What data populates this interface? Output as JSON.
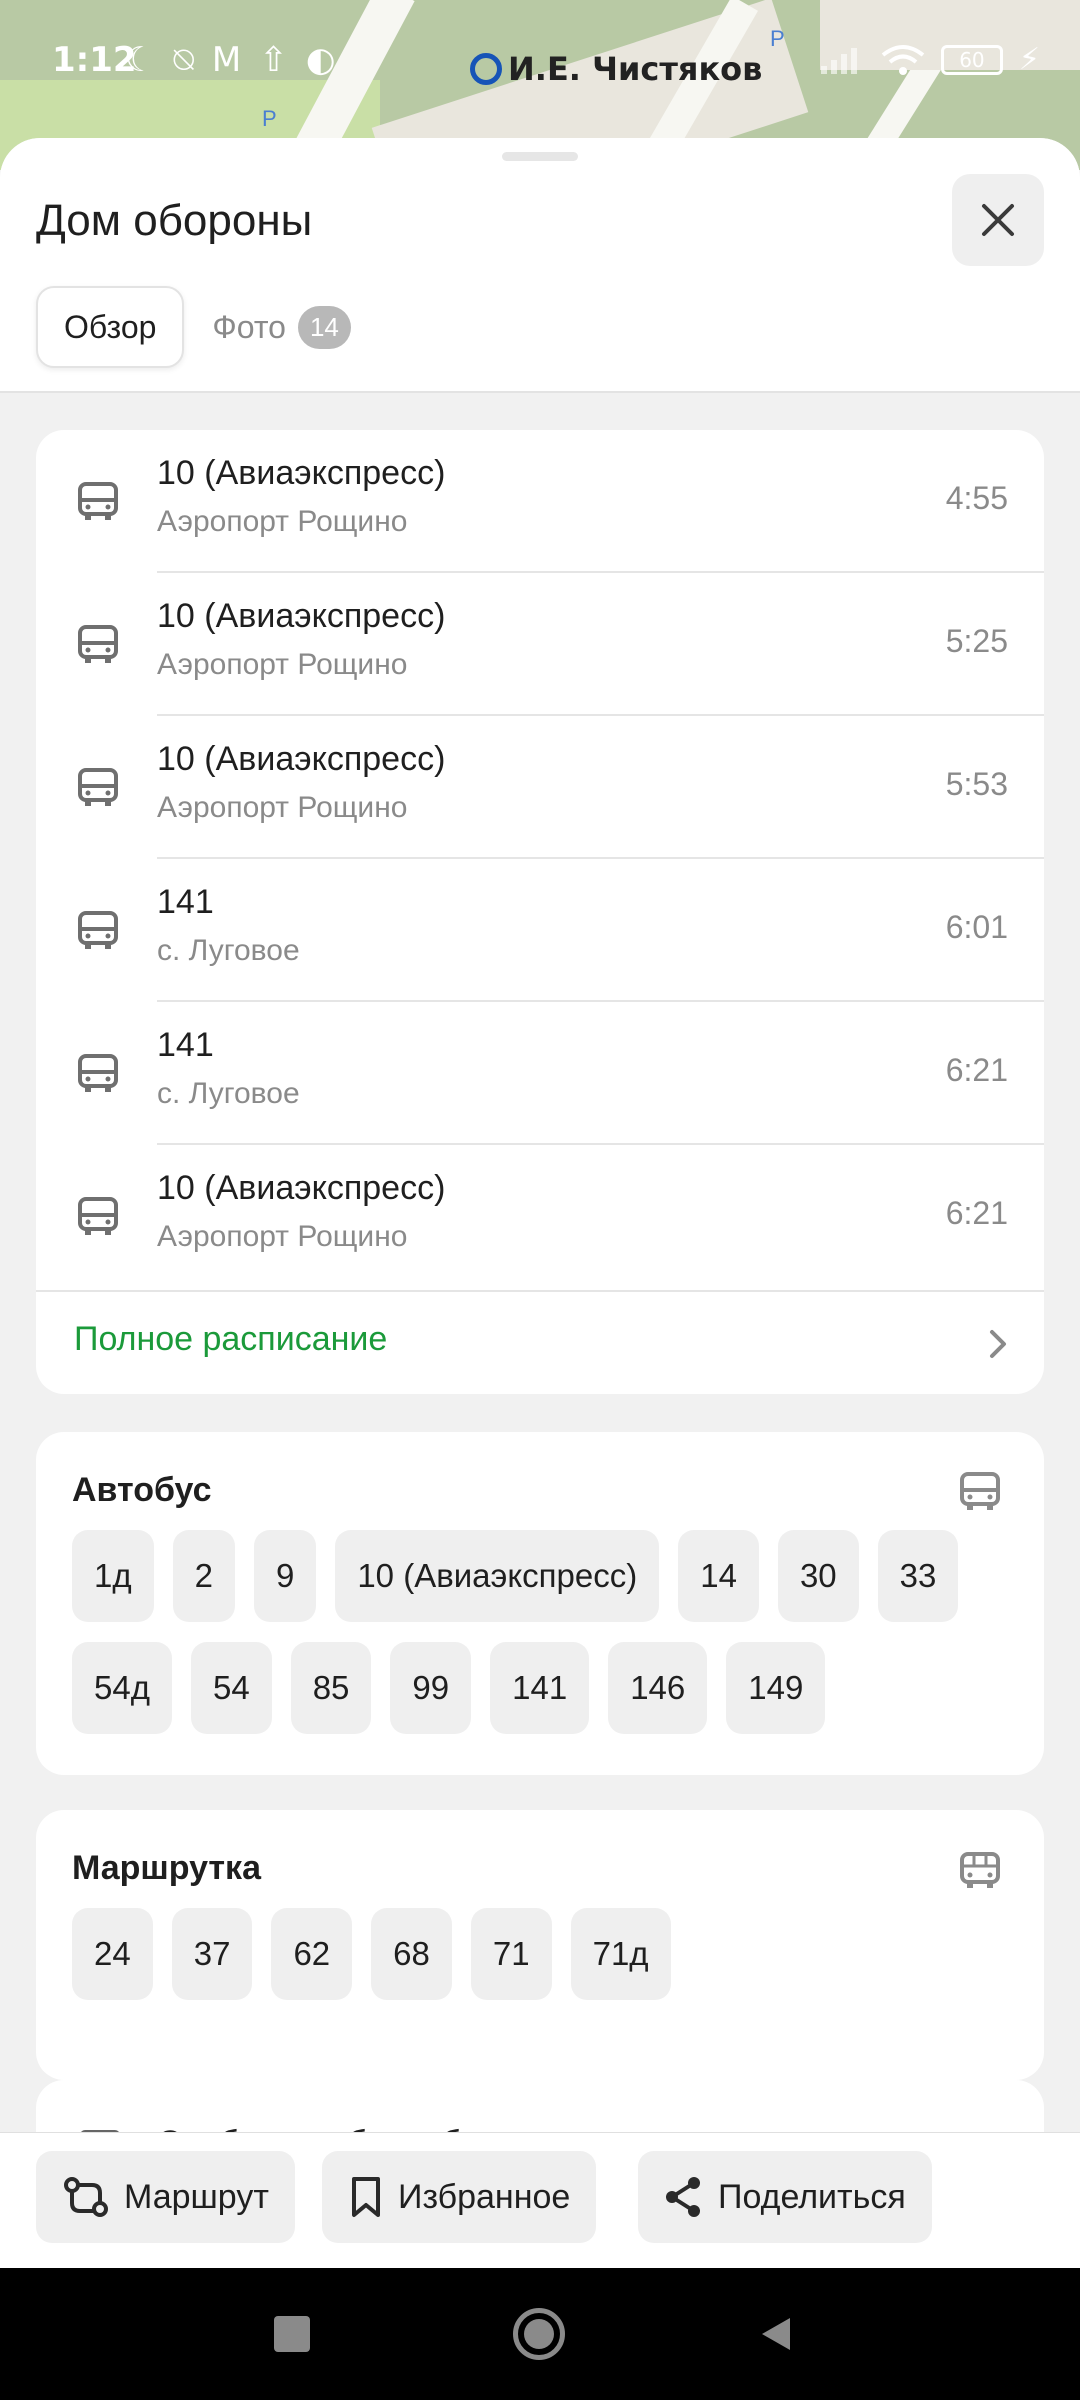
{
  "status_bar": {
    "time": "1:12",
    "battery": "60",
    "metro_station": "И.Е. Чистяков"
  },
  "map": {
    "parking_label": "P"
  },
  "sheet": {
    "title": "Дом обороны",
    "tabs": [
      {
        "label": "Обзор",
        "active": true
      },
      {
        "label": "Фото",
        "badge": "14",
        "active": false
      }
    ]
  },
  "schedule": {
    "rows": [
      {
        "route": "10 (Авиаэкспресс)",
        "destination": "Аэропорт Рощино",
        "time": "4:55"
      },
      {
        "route": "10 (Авиаэкспресс)",
        "destination": "Аэропорт Рощино",
        "time": "5:25"
      },
      {
        "route": "10 (Авиаэкспресс)",
        "destination": "Аэропорт Рощино",
        "time": "5:53"
      },
      {
        "route": "141",
        "destination": "с. Луговое",
        "time": "6:01"
      },
      {
        "route": "141",
        "destination": "с. Луговое",
        "time": "6:21"
      },
      {
        "route": "10 (Авиаэкспресс)",
        "destination": "Аэропорт Рощино",
        "time": "6:21"
      }
    ],
    "full_schedule_label": "Полное расписание"
  },
  "bus": {
    "title": "Автобус",
    "routes": [
      "1д",
      "2",
      "9",
      "10 (Авиаэкспресс)",
      "14",
      "30",
      "33",
      "54д",
      "54",
      "85",
      "99",
      "141",
      "146",
      "149"
    ]
  },
  "minibus": {
    "title": "Маршрутка",
    "routes": [
      "24",
      "37",
      "62",
      "68",
      "71",
      "71д"
    ]
  },
  "report": {
    "label": "Сообщить об ошибке в данных"
  },
  "actions": {
    "route": "Маршрут",
    "favorites": "Избранное",
    "share": "Поделиться"
  },
  "colors": {
    "accent_green": "#1b9a3a",
    "metro_blue": "#1654b7"
  }
}
